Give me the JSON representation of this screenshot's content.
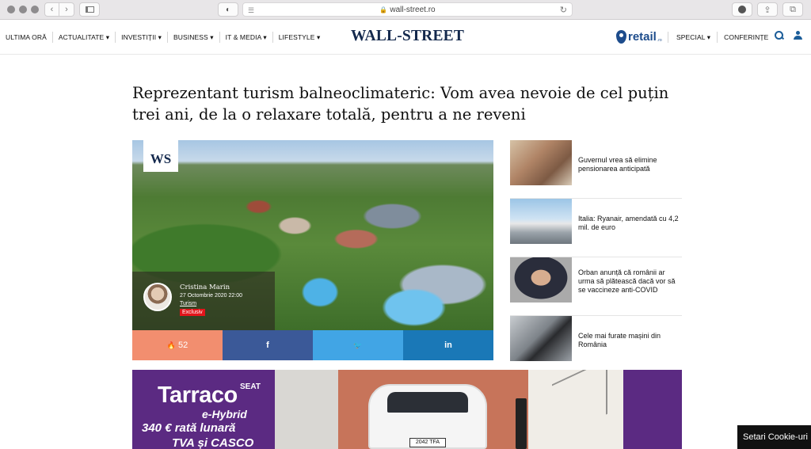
{
  "browser": {
    "url": "wall-street.ro",
    "icons": [
      "back-icon",
      "forward-icon",
      "sidebar-icon",
      "shield-icon",
      "reader-icon",
      "lock-icon",
      "reload-icon",
      "download-icon",
      "share-icon",
      "tabs-icon"
    ]
  },
  "header": {
    "menu_left": [
      {
        "label": "ULTIMA ORĂ"
      },
      {
        "label": "ACTUALITATE"
      },
      {
        "label": "INVESTIȚII"
      },
      {
        "label": "BUSINESS"
      },
      {
        "label": "IT & MEDIA"
      },
      {
        "label": "LIFESTYLE"
      }
    ],
    "logo": "WALL-STREET",
    "retail_logo": "retail",
    "retail_sub": ".ro",
    "menu_right": [
      {
        "label": "SPECIAL"
      },
      {
        "label": "CONFERINȚE"
      }
    ],
    "dropdown_glyph": "▾"
  },
  "article": {
    "headline": "Reprezentant turism balneoclimateric: Vom avea nevoie de cel puțin trei ani, de la o relaxare totală, pentru a ne reveni",
    "badge": "WS",
    "author": "Cristina Marin",
    "date": "27 Octombrie 2020 22:00",
    "category": "Turism",
    "tag": "Exclusiv",
    "share": {
      "count": "52",
      "fire_glyph": "🔥",
      "facebook_glyph": "f",
      "twitter_glyph": "🐦",
      "linkedin_glyph": "in"
    }
  },
  "side_news": [
    {
      "title": "Guvernul vrea să elimine pensionarea anticipată"
    },
    {
      "title": "Italia: Ryanair, amendată cu 4,2 mil. de euro"
    },
    {
      "title": "Orban anunță că românii ar urma să plătească dacă vor să se vaccineze anti-COVID"
    },
    {
      "title": "Cele mai furate mașini din România"
    }
  ],
  "ad": {
    "brand": "SEAT",
    "model": "Tarraco",
    "variant": "e-Hybrid",
    "price": "340 € rată lunară",
    "tva": "TVA și CASCO",
    "plate": "2042 TFA"
  },
  "cookie": "Setari Cookie-uri",
  "colors": {
    "logo": "#14294d",
    "accent_blue": "#1b5d99",
    "share_count": "#f28e6f",
    "facebook": "#3b5998",
    "twitter": "#41a5e5",
    "linkedin": "#1a78b7",
    "tag_red": "#e3141b",
    "ad_purple": "#5b2a82"
  }
}
